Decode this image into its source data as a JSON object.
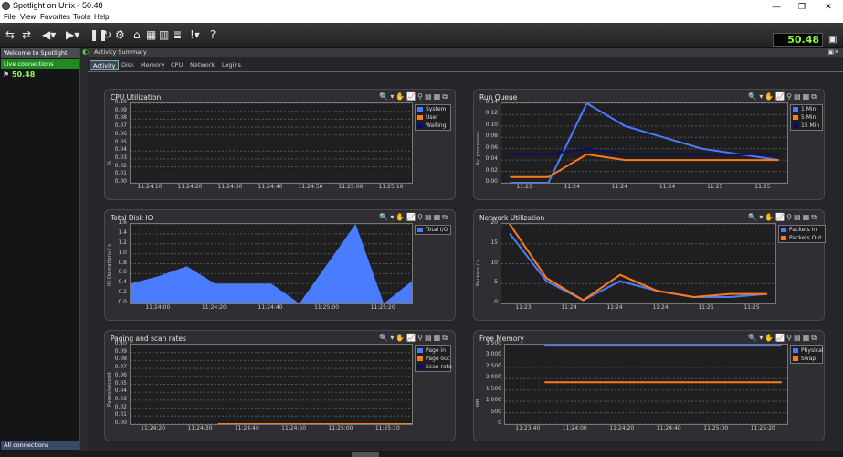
{
  "window": {
    "title": "Spotlight on Unix - 50.48",
    "minimize": "—",
    "maximize": "❐",
    "close": "✕"
  },
  "menu": {
    "items": [
      "File",
      "View",
      "Favorites",
      "Tools",
      "Help"
    ]
  },
  "toolbar": {
    "value": "50.48"
  },
  "sidebar": {
    "welcome": "Welcome to Spotlight",
    "live": "Live connections",
    "connection": "50.48",
    "all": "All connections"
  },
  "panel": {
    "title": "Activity Summary",
    "tabs": [
      "Activity",
      "Disk",
      "Memory",
      "CPU",
      "Network",
      "Logins"
    ]
  },
  "charts": {
    "cpu": {
      "title": "CPU Utilization",
      "ylabel": "%",
      "yticks": [
        "0.10",
        "0.09",
        "0.08",
        "0.07",
        "0.06",
        "0.05",
        "0.04",
        "0.03",
        "0.02",
        "0.01",
        "0.00"
      ],
      "xticks": [
        "11:24:10",
        "11:24:20",
        "11:24:30",
        "11:24:40",
        "11:24:50",
        "11:25:00",
        "11:25:10"
      ],
      "legend": [
        "System",
        "User",
        "Waiting"
      ]
    },
    "runq": {
      "title": "Run Queue",
      "ylabel": "Av. processes",
      "yticks": [
        "0.14",
        "0.12",
        "0.10",
        "0.08",
        "0.06",
        "0.04",
        "0.02",
        "0.00"
      ],
      "xticks": [
        "11:23",
        "11:24",
        "11:24",
        "11:24",
        "11:25",
        "11:25"
      ],
      "legend": [
        "1 Min",
        "5 Min",
        "15 Min"
      ]
    },
    "disk": {
      "title": "Total Disk IO",
      "ylabel": "IO Operations / s",
      "yticks": [
        "1.6",
        "1.4",
        "1.2",
        "1.0",
        "0.8",
        "0.6",
        "0.4",
        "0.2",
        "0.0"
      ],
      "xticks": [
        "11:24:00",
        "11:24:20",
        "11:24:40",
        "11:25:00",
        "11:25:20"
      ],
      "legend": [
        "Total I/O"
      ]
    },
    "net": {
      "title": "Network Utilization",
      "ylabel": "Packets / s",
      "yticks": [
        "20",
        "15",
        "10",
        "5",
        "0"
      ],
      "xticks": [
        "11:23",
        "11:24",
        "11:24",
        "11:24",
        "11:25",
        "11:25"
      ],
      "legend": [
        "Packets In",
        "Packets Out"
      ]
    },
    "paging": {
      "title": "Paging and scan rates",
      "ylabel": "Pages/second",
      "yticks": [
        "0.10",
        "0.09",
        "0.08",
        "0.07",
        "0.06",
        "0.05",
        "0.04",
        "0.03",
        "0.02",
        "0.01",
        "0.00"
      ],
      "xticks": [
        "11:24:20",
        "11:24:30",
        "11:24:40",
        "11:24:50",
        "11:25:00",
        "11:25:10"
      ],
      "legend": [
        "Page in",
        "Page out",
        "Scan rate"
      ]
    },
    "mem": {
      "title": "Free Memory",
      "ylabel": "MB",
      "yticks": [
        "3,500",
        "3,000",
        "2,500",
        "2,000",
        "1,500",
        "1,000",
        "500",
        "0"
      ],
      "xticks": [
        "11:23:40",
        "11:24:00",
        "11:24:20",
        "11:24:40",
        "11:25:00",
        "11:25:20"
      ],
      "legend": [
        "Physical",
        "Swap"
      ]
    }
  },
  "chart_data": [
    {
      "type": "area",
      "title": "CPU Utilization",
      "ylabel": "%",
      "x": [
        "11:24:10",
        "11:24:20",
        "11:24:30",
        "11:24:40",
        "11:24:50",
        "11:25:00",
        "11:25:10"
      ],
      "ylim": [
        0,
        0.1
      ],
      "series": [
        {
          "name": "System",
          "values": []
        },
        {
          "name": "User",
          "values": []
        },
        {
          "name": "Waiting",
          "values": []
        }
      ]
    },
    {
      "type": "line",
      "title": "Run Queue",
      "ylabel": "Av. processes",
      "ylim": [
        0,
        0.14
      ],
      "x": [
        "11:23",
        "11:24",
        "11:24",
        "11:24",
        "11:25",
        "11:25"
      ],
      "series": [
        {
          "name": "1 Min",
          "color": "#4a7cff",
          "values": [
            0,
            0,
            0.14,
            0.1,
            0.08,
            0.06,
            0.05,
            0.04
          ]
        },
        {
          "name": "5 Min",
          "color": "#ff7a1a",
          "values": [
            0.01,
            0.01,
            0.05,
            0.04,
            0.04,
            0.04,
            0.04,
            0.04
          ]
        },
        {
          "name": "15 Min",
          "color": "#0a0a70",
          "values": [
            0.05,
            0.05,
            0.06,
            0.05,
            0.05,
            0.05,
            0.05,
            0.05
          ]
        }
      ]
    },
    {
      "type": "area",
      "title": "Total Disk IO",
      "ylabel": "IO Operations / s",
      "ylim": [
        0,
        1.6
      ],
      "x": [
        "11:24:00",
        "11:24:20",
        "11:24:40",
        "11:25:00",
        "11:25:20"
      ],
      "series": [
        {
          "name": "Total I/O",
          "color": "#4a7cff",
          "values": [
            0.4,
            0.55,
            0.75,
            0.4,
            0.4,
            0.4,
            0.0,
            0.8,
            1.6,
            0.0,
            0.45
          ]
        }
      ]
    },
    {
      "type": "line",
      "title": "Network Utilization",
      "ylabel": "Packets / s",
      "ylim": [
        0,
        25
      ],
      "x": [
        "11:23",
        "11:24",
        "11:24",
        "11:24",
        "11:25",
        "11:25"
      ],
      "series": [
        {
          "name": "Packets In",
          "color": "#4a7cff",
          "values": [
            22,
            7,
            1,
            7,
            4,
            2,
            2,
            3
          ]
        },
        {
          "name": "Packets Out",
          "color": "#ff7a1a",
          "values": [
            25,
            8,
            1,
            9,
            4,
            2,
            3,
            3
          ]
        }
      ]
    },
    {
      "type": "line",
      "title": "Paging and scan rates",
      "ylabel": "Pages/second",
      "ylim": [
        0,
        0.1
      ],
      "x": [
        "11:24:20",
        "11:24:30",
        "11:24:40",
        "11:24:50",
        "11:25:00",
        "11:25:10"
      ],
      "series": [
        {
          "name": "Page in",
          "values": []
        },
        {
          "name": "Page out",
          "color": "#ff7a1a",
          "values": [
            0,
            0,
            0,
            0,
            0,
            0
          ]
        },
        {
          "name": "Scan rate",
          "values": []
        }
      ]
    },
    {
      "type": "line",
      "title": "Free Memory",
      "ylabel": "MB",
      "ylim": [
        0,
        3800
      ],
      "x": [
        "11:23:40",
        "11:24:00",
        "11:24:20",
        "11:24:40",
        "11:25:00",
        "11:25:20"
      ],
      "series": [
        {
          "name": "Physical",
          "color": "#4a7cff",
          "values": [
            3750,
            3750,
            3750,
            3750,
            3750,
            3750
          ]
        },
        {
          "name": "Swap",
          "color": "#ff7a1a",
          "values": [
            2000,
            2000,
            2000,
            2000,
            2000,
            2000
          ]
        }
      ]
    }
  ]
}
